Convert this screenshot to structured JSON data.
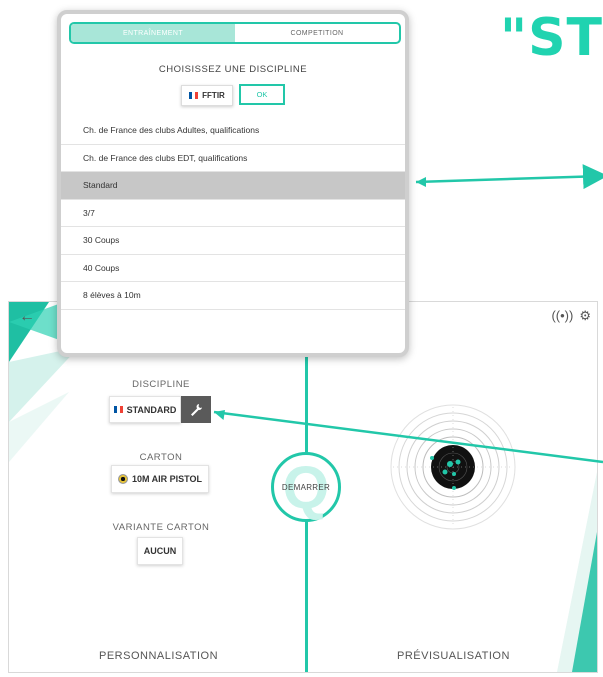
{
  "headline": "\"ST",
  "popup": {
    "tabs": [
      {
        "label": "ENTRAÎNEMENT",
        "active": true
      },
      {
        "label": "COMPETITION",
        "active": false
      }
    ],
    "prompt": "CHOISISSEZ UNE DISCIPLINE",
    "federation_button": "FFTIR",
    "ok_button": "OK",
    "disciplines": [
      {
        "label": "Ch. de France des clubs Adultes, qualifications",
        "selected": false
      },
      {
        "label": "Ch. de France des clubs EDT, qualifications",
        "selected": false
      },
      {
        "label": "Standard",
        "selected": true
      },
      {
        "label": "3/7",
        "selected": false
      },
      {
        "label": "30 Coups",
        "selected": false
      },
      {
        "label": "40 Coups",
        "selected": false
      },
      {
        "label": "8 élèves à 10m",
        "selected": false
      }
    ]
  },
  "app": {
    "discipline_label": "DISCIPLINE",
    "discipline_value": "STANDARD",
    "carton_label": "CARTON",
    "carton_value": "10M AIR PISTOL",
    "variante_label": "VARIANTE CARTON",
    "variante_value": "AUCUN",
    "start_button": "DEMARRER",
    "footer_left": "PERSONNALISATION",
    "footer_right": "PRÉVISUALISATION",
    "icons": [
      "back-arrow-icon",
      "wireless-lock-icon",
      "settings-gear-icon",
      "wrench-icon"
    ]
  },
  "colors": {
    "accent": "#22c7a9",
    "flag_blue": "#0055a4",
    "flag_white": "#ffffff",
    "flag_red": "#ef4135",
    "selected_row": "#c7c7c7",
    "target_black": "#111111"
  }
}
